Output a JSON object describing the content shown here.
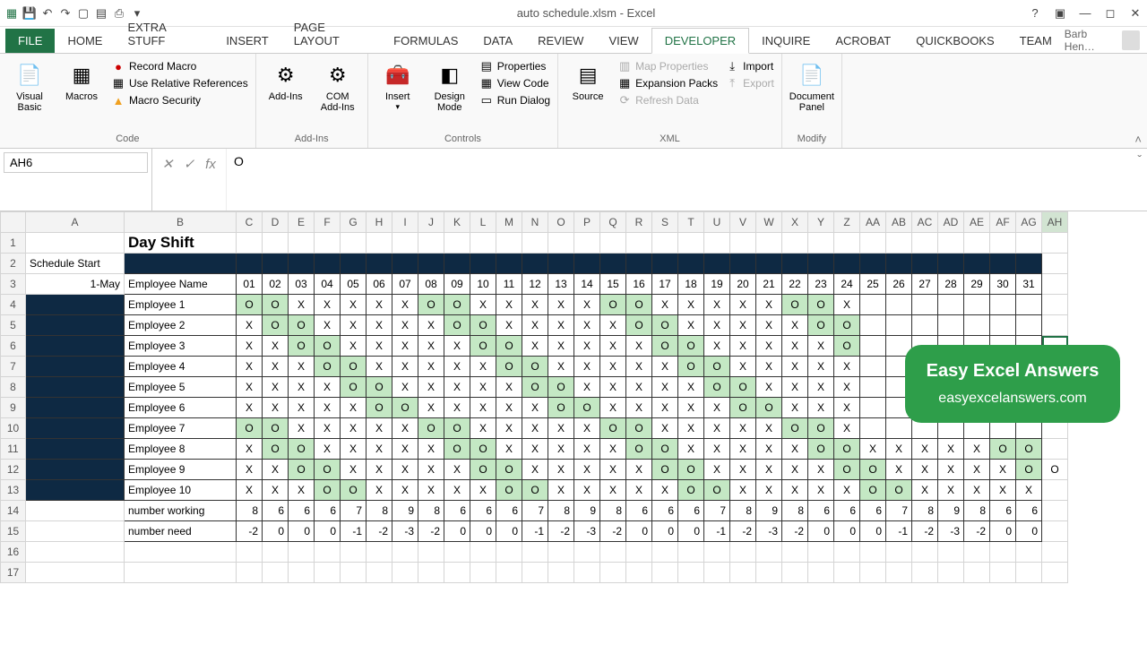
{
  "window": {
    "title": "auto schedule.xlsm - Excel",
    "user": "Barb Hen…"
  },
  "tabs": [
    "FILE",
    "HOME",
    "extra stuff",
    "INSERT",
    "PAGE LAYOUT",
    "FORMULAS",
    "DATA",
    "REVIEW",
    "VIEW",
    "DEVELOPER",
    "INQUIRE",
    "ACROBAT",
    "QuickBooks",
    "TEAM"
  ],
  "active_tab": "DEVELOPER",
  "ribbon": {
    "code": {
      "label": "Code",
      "vb": "Visual\nBasic",
      "macros": "Macros",
      "items": [
        "Record Macro",
        "Use Relative References",
        "Macro Security"
      ]
    },
    "addins": {
      "label": "Add-Ins",
      "addins": "Add-Ins",
      "com": "COM\nAdd-Ins"
    },
    "controls": {
      "label": "Controls",
      "insert": "Insert",
      "design": "Design\nMode",
      "items": [
        "Properties",
        "View Code",
        "Run Dialog"
      ]
    },
    "xml": {
      "label": "XML",
      "source": "Source",
      "left": [
        "Map Properties",
        "Expansion Packs",
        "Refresh Data"
      ],
      "right": [
        "Import",
        "Export"
      ]
    },
    "modify": {
      "label": "Modify",
      "doc": "Document\nPanel"
    }
  },
  "fbar": {
    "name": "AH6",
    "formula": "O"
  },
  "cols": [
    "A",
    "B",
    "C",
    "D",
    "E",
    "F",
    "G",
    "H",
    "I",
    "J",
    "K",
    "L",
    "M",
    "N",
    "O",
    "P",
    "Q",
    "R",
    "S",
    "T",
    "U",
    "V",
    "W",
    "X",
    "Y",
    "Z",
    "AA",
    "AB",
    "AC",
    "AD",
    "AE",
    "AF",
    "AG",
    "AH"
  ],
  "sel_col": "AH",
  "sheet": {
    "title": "Day Shift",
    "a2": "Schedule Start",
    "a3": "1-May",
    "b3": "Employee Name",
    "days": [
      "01",
      "02",
      "03",
      "04",
      "05",
      "06",
      "07",
      "08",
      "09",
      "10",
      "11",
      "12",
      "13",
      "14",
      "15",
      "16",
      "17",
      "18",
      "19",
      "20",
      "21",
      "22",
      "23",
      "24",
      "25",
      "26",
      "27",
      "28",
      "29",
      "30",
      "31"
    ],
    "employees": [
      {
        "name": "Employee 1",
        "v": [
          "O",
          "O",
          "X",
          "X",
          "X",
          "X",
          "X",
          "O",
          "O",
          "X",
          "X",
          "X",
          "X",
          "X",
          "O",
          "O",
          "X",
          "X",
          "X",
          "X",
          "X",
          "O",
          "O",
          "X",
          "",
          "",
          "",
          "",
          "",
          "",
          ""
        ]
      },
      {
        "name": "Employee 2",
        "v": [
          "X",
          "O",
          "O",
          "X",
          "X",
          "X",
          "X",
          "X",
          "O",
          "O",
          "X",
          "X",
          "X",
          "X",
          "X",
          "O",
          "O",
          "X",
          "X",
          "X",
          "X",
          "X",
          "O",
          "O",
          "",
          "",
          "",
          "",
          "",
          "",
          ""
        ]
      },
      {
        "name": "Employee 3",
        "v": [
          "X",
          "X",
          "O",
          "O",
          "X",
          "X",
          "X",
          "X",
          "X",
          "O",
          "O",
          "X",
          "X",
          "X",
          "X",
          "X",
          "O",
          "O",
          "X",
          "X",
          "X",
          "X",
          "X",
          "O",
          "",
          "",
          "",
          "",
          "",
          "",
          ""
        ]
      },
      {
        "name": "Employee 4",
        "v": [
          "X",
          "X",
          "X",
          "O",
          "O",
          "X",
          "X",
          "X",
          "X",
          "X",
          "O",
          "O",
          "X",
          "X",
          "X",
          "X",
          "X",
          "O",
          "O",
          "X",
          "X",
          "X",
          "X",
          "X",
          "",
          "",
          "",
          "",
          "",
          "",
          ""
        ]
      },
      {
        "name": "Employee 5",
        "v": [
          "X",
          "X",
          "X",
          "X",
          "O",
          "O",
          "X",
          "X",
          "X",
          "X",
          "X",
          "O",
          "O",
          "X",
          "X",
          "X",
          "X",
          "X",
          "O",
          "O",
          "X",
          "X",
          "X",
          "X",
          "",
          "",
          "",
          "",
          "",
          "",
          ""
        ]
      },
      {
        "name": "Employee 6",
        "v": [
          "X",
          "X",
          "X",
          "X",
          "X",
          "O",
          "O",
          "X",
          "X",
          "X",
          "X",
          "X",
          "O",
          "O",
          "X",
          "X",
          "X",
          "X",
          "X",
          "O",
          "O",
          "X",
          "X",
          "X",
          "",
          "",
          "",
          "",
          "",
          "",
          ""
        ]
      },
      {
        "name": "Employee 7",
        "v": [
          "O",
          "O",
          "X",
          "X",
          "X",
          "X",
          "X",
          "O",
          "O",
          "X",
          "X",
          "X",
          "X",
          "X",
          "O",
          "O",
          "X",
          "X",
          "X",
          "X",
          "X",
          "O",
          "O",
          "X",
          "",
          "",
          "",
          "",
          "",
          "",
          ""
        ]
      },
      {
        "name": "Employee 8",
        "v": [
          "X",
          "O",
          "O",
          "X",
          "X",
          "X",
          "X",
          "X",
          "O",
          "O",
          "X",
          "X",
          "X",
          "X",
          "X",
          "O",
          "O",
          "X",
          "X",
          "X",
          "X",
          "X",
          "O",
          "O",
          "X",
          "X",
          "X",
          "X",
          "X",
          "O",
          "O"
        ]
      },
      {
        "name": "Employee 9",
        "v": [
          "X",
          "X",
          "O",
          "O",
          "X",
          "X",
          "X",
          "X",
          "X",
          "O",
          "O",
          "X",
          "X",
          "X",
          "X",
          "X",
          "O",
          "O",
          "X",
          "X",
          "X",
          "X",
          "X",
          "O",
          "O",
          "X",
          "X",
          "X",
          "X",
          "X",
          "O"
        ]
      },
      {
        "name": "Employee 10",
        "v": [
          "X",
          "X",
          "X",
          "O",
          "O",
          "X",
          "X",
          "X",
          "X",
          "X",
          "O",
          "O",
          "X",
          "X",
          "X",
          "X",
          "X",
          "O",
          "O",
          "X",
          "X",
          "X",
          "X",
          "X",
          "O",
          "O",
          "X",
          "X",
          "X",
          "X",
          "X"
        ]
      }
    ],
    "rw": {
      "label": "number working",
      "v": [
        "8",
        "6",
        "6",
        "6",
        "7",
        "8",
        "9",
        "8",
        "6",
        "6",
        "6",
        "7",
        "8",
        "9",
        "8",
        "6",
        "6",
        "6",
        "7",
        "8",
        "9",
        "8",
        "6",
        "6",
        "6",
        "7",
        "8",
        "9",
        "8",
        "6",
        "6"
      ]
    },
    "rn": {
      "label": "number need",
      "v": [
        "-2",
        "0",
        "0",
        "0",
        "-1",
        "-2",
        "-3",
        "-2",
        "0",
        "0",
        "0",
        "-1",
        "-2",
        "-3",
        "-2",
        "0",
        "0",
        "0",
        "-1",
        "-2",
        "-3",
        "-2",
        "0",
        "0",
        "0",
        "-1",
        "-2",
        "-3",
        "-2",
        "0",
        "0"
      ]
    }
  },
  "watermark": {
    "l1": "Easy Excel Answers",
    "l2": "easyexcelanswers.com"
  },
  "sel_cell": {
    "row": 6,
    "col": "AH"
  }
}
